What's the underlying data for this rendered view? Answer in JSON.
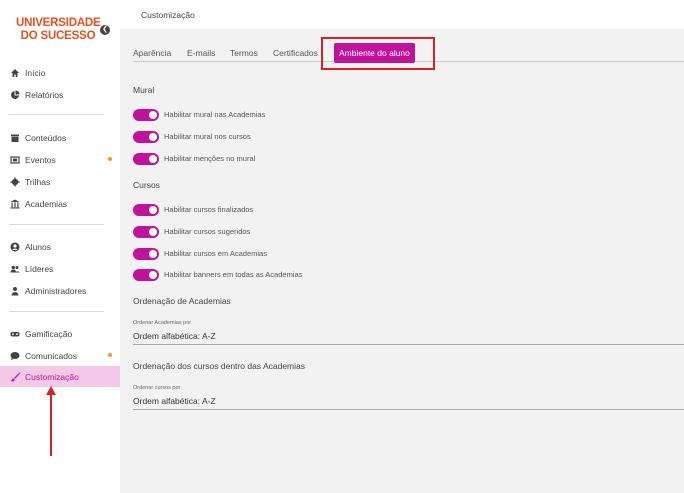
{
  "brand": {
    "line1": "UNIVERSIDADE",
    "line2": "DO SUCESSO",
    "color": "#e8501c"
  },
  "accent": "#c0129a",
  "sidebar": {
    "items": [
      {
        "label": "Início",
        "icon": "home-icon"
      },
      {
        "label": "Relatórios",
        "icon": "pie-chart-icon"
      },
      {
        "label": "Conteúdos",
        "icon": "archive-icon"
      },
      {
        "label": "Eventos",
        "icon": "event-icon",
        "dot": true
      },
      {
        "label": "Trilhas",
        "icon": "gear-icon"
      },
      {
        "label": "Academias",
        "icon": "institution-icon"
      },
      {
        "label": "Alunos",
        "icon": "user-icon"
      },
      {
        "label": "Líderes",
        "icon": "users-icon"
      },
      {
        "label": "Administradores",
        "icon": "admin-icon"
      },
      {
        "label": "Gamificação",
        "icon": "gamepad-icon"
      },
      {
        "label": "Comunicados",
        "icon": "chat-icon",
        "dot": true
      },
      {
        "label": "Customização",
        "icon": "brush-icon",
        "active": true
      }
    ]
  },
  "header": {
    "title": "Customização"
  },
  "tabs": [
    "Aparência",
    "E-mails",
    "Termos",
    "Certificados",
    "Ambiente do aluno"
  ],
  "mural": {
    "title": "Mural",
    "toggles": [
      "Habilitar mural nas Academias",
      "Habilitar mural nos cursos",
      "Habilitar menções no mural"
    ]
  },
  "cursos": {
    "title": "Cursos",
    "toggles": [
      "Habilitar cursos finalizados",
      "Habilitar cursos sugeridos",
      "Habilitar cursos em Academias",
      "Habilitar banners em todas as Academias"
    ]
  },
  "ordenacao_academias": {
    "title": "Ordenação de Academias",
    "label": "Ordenar Academias por",
    "value": "Ordem alfabética: A-Z"
  },
  "ordenacao_cursos": {
    "title": "Ordenação dos cursos dentro das Academias",
    "label": "Ordenar cursos por",
    "value": "Ordem alfabética: A-Z"
  }
}
